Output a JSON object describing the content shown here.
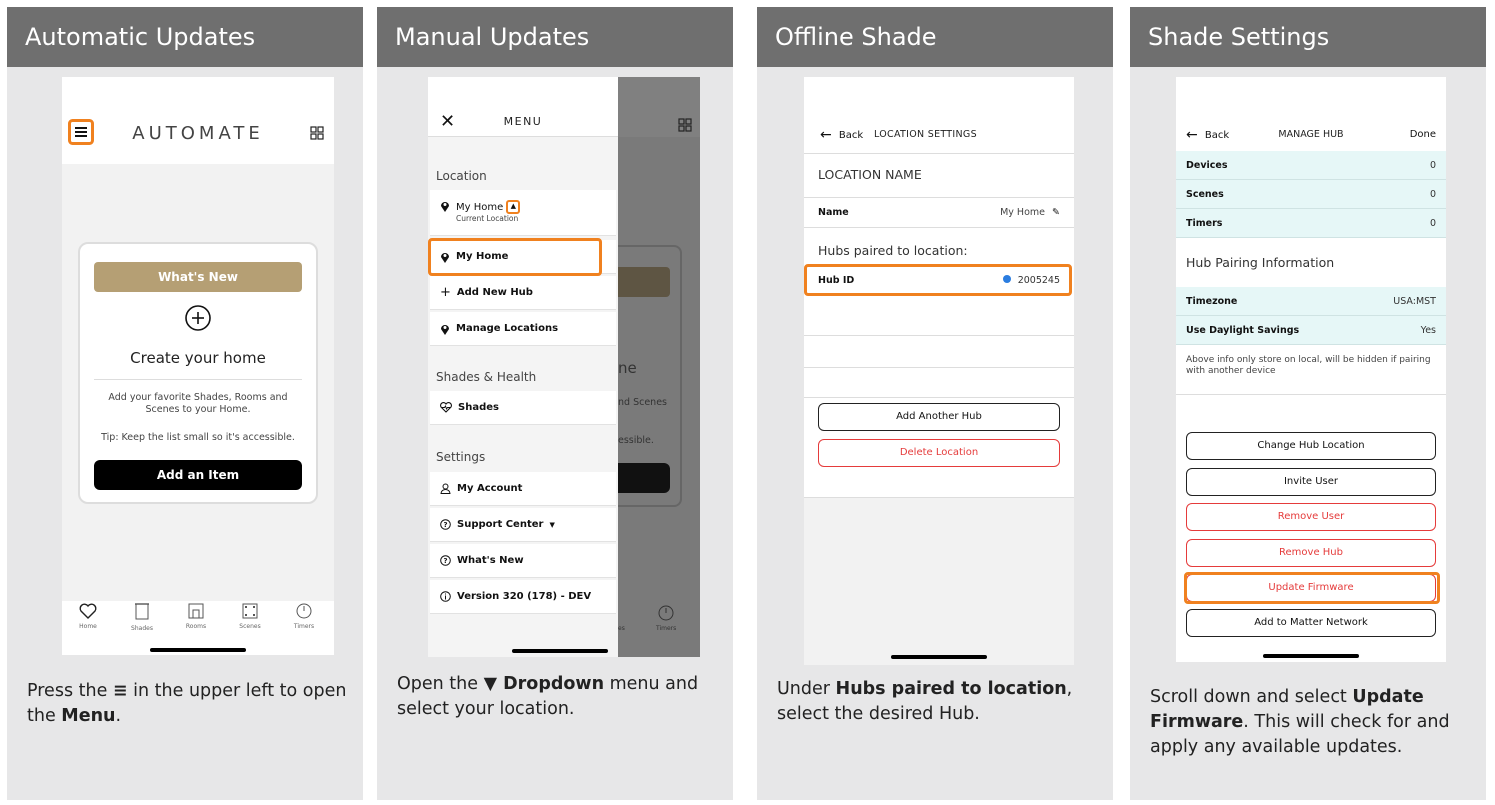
{
  "panels": [
    {
      "title": "Automatic Updates",
      "caption_parts": [
        "Press the ",
        "≡",
        " in the upper left to open the ",
        "Menu",
        "."
      ],
      "screen": {
        "logo": "AUTOMATE",
        "card_whatsnew": "What's New",
        "card_title": "Create your home",
        "card_text": "Add your favorite Shades, Rooms and Scenes to your Home.",
        "card_tip": "Tip: Keep the list small so it's accessible.",
        "add_button": "Add an Item",
        "tabs": [
          "Home",
          "Shades",
          "Rooms",
          "Scenes",
          "Timers"
        ]
      }
    },
    {
      "title": "Manual Updates",
      "caption_parts": [
        "Open the ",
        "▼ Dropdown",
        " menu and select your location."
      ],
      "screen": {
        "menu_title": "MENU",
        "section_location": "Location",
        "current_name": "My Home",
        "current_sub": "Current Location",
        "item_my_home": "My Home",
        "item_add_hub": "Add New Hub",
        "item_manage": "Manage Locations",
        "section_shades": "Shades & Health",
        "item_shades": "Shades",
        "section_settings": "Settings",
        "item_account": "My Account",
        "item_support": "Support Center",
        "item_whatsnew": "What's New",
        "item_version": "Version 320 (178) - DEV",
        "behind_text1": "ne",
        "behind_text2": "nd Scenes",
        "behind_text3": "essible.",
        "behind_tab": "Timers",
        "behind_tab_cut": "es"
      }
    },
    {
      "title": "Offline Shade",
      "caption_parts": [
        "Under ",
        "Hubs paired to location",
        ", select the desired Hub."
      ],
      "screen": {
        "back": "Back",
        "title": "LOCATION SETTINGS",
        "section_name": "LOCATION NAME",
        "name_key": "Name",
        "name_value": "My Home",
        "section_hubs": "Hubs paired to location:",
        "hub_key": "Hub ID",
        "hub_value": "2005245",
        "add_hub": "Add Another Hub",
        "delete_location": "Delete Location"
      }
    },
    {
      "title": "Shade Settings",
      "caption_parts": [
        "Scroll down and select ",
        "Update Firmware",
        ". This will check for and apply any available updates."
      ],
      "screen": {
        "back": "Back",
        "title": "MANAGE HUB",
        "done": "Done",
        "rows": [
          {
            "key": "Devices",
            "value": "0"
          },
          {
            "key": "Scenes",
            "value": "0"
          },
          {
            "key": "Timers",
            "value": "0"
          }
        ],
        "section_pairing": "Hub Pairing Information",
        "rows2": [
          {
            "key": "Timezone",
            "value": "USA:MST"
          },
          {
            "key": "Use Daylight Savings",
            "value": "Yes"
          }
        ],
        "note": "Above info only store on local, will be hidden if pairing with another device",
        "buttons": [
          "Change Hub Location",
          "Invite User",
          "Remove User",
          "Remove Hub",
          "Update Firmware",
          "Add to Matter Network"
        ]
      }
    }
  ],
  "colors": {
    "panel_bg": "#e7e7e8",
    "header_bg": "#6f6f6f",
    "highlight": "#f0811f",
    "gold": "#b59f74",
    "red": "#e53b3b",
    "teal_row": "#e6f7f7"
  }
}
